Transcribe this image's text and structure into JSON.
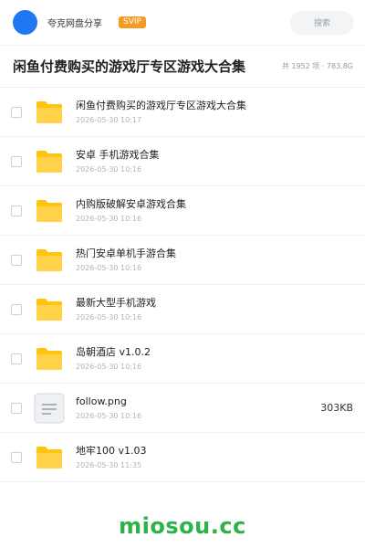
{
  "header": {
    "app_name": "夸克网盘分享",
    "badge": "SVIP",
    "search_placeholder": "搜索"
  },
  "title_bar": {
    "title": "闲鱼付费购买的游戏厅专区游戏大合集",
    "summary": "共 1952 项 · 783.8G"
  },
  "files": [
    {
      "name": "闲鱼付费购买的游戏厅专区游戏大合集",
      "date": "2026-05-30 10:17",
      "type": "folder",
      "size": ""
    },
    {
      "name": "安卓 手机游戏合集",
      "date": "2026-05-30 10:16",
      "type": "folder",
      "size": ""
    },
    {
      "name": "内购版破解安卓游戏合集",
      "date": "2026-05-30 10:16",
      "type": "folder",
      "size": ""
    },
    {
      "name": "热门安卓单机手游合集",
      "date": "2026-05-30 10:16",
      "type": "folder",
      "size": ""
    },
    {
      "name": "最新大型手机游戏",
      "date": "2026-05-30 10:16",
      "type": "folder",
      "size": ""
    },
    {
      "name": "岛朝酒店 v1.0.2",
      "date": "2026-05-30 10:16",
      "type": "folder",
      "size": ""
    },
    {
      "name": "follow.png",
      "date": "2026-05-30 10:16",
      "type": "file",
      "size": "303KB"
    },
    {
      "name": "地牢100 v1.03",
      "date": "2026-05-30 11:35",
      "type": "folder",
      "size": ""
    }
  ],
  "watermark": "miosou.cc",
  "colors": {
    "avatar": "#1f77f2",
    "badge": "#f59a23",
    "folder": "#ffc40d",
    "watermark": "#2bb34a"
  }
}
